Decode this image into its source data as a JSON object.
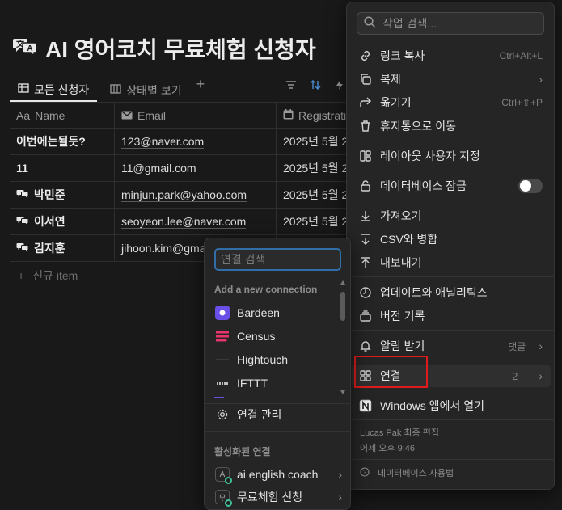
{
  "page": {
    "title": "AI 영어코치 무료체험 신청자",
    "icon": "translate-chat-icon",
    "views": [
      {
        "label": "모든 신청자",
        "icon": "table-icon"
      },
      {
        "label": "상태별 보기",
        "icon": "board-icon"
      }
    ],
    "add_view": "+",
    "toolbar_icons": [
      "filter-icon",
      "sort-icon",
      "automation-icon"
    ],
    "accent_color": "#2f6ea8"
  },
  "table": {
    "columns": [
      {
        "label": "Name",
        "icon": "Aa"
      },
      {
        "label": "Email",
        "icon": "mail-icon"
      },
      {
        "label": "Registration",
        "icon": "calendar-icon"
      }
    ],
    "rows": [
      {
        "name": "이번에는될듯?",
        "email": "123@naver.com",
        "date": "2025년 5월 2",
        "has_icon": false
      },
      {
        "name": "11",
        "email": "11@gmail.com",
        "date": "2025년 5월 2",
        "has_icon": false
      },
      {
        "name": "박민준",
        "email": "minjun.park@yahoo.com",
        "date": "2025년 5월 2",
        "has_icon": true
      },
      {
        "name": "이서연",
        "email": "seoyeon.lee@naver.com",
        "date": "2025년 5월 2",
        "has_icon": true
      },
      {
        "name": "김지훈",
        "email": "jihoon.kim@gma",
        "date": "",
        "has_icon": true
      }
    ],
    "new_item": "신규 item"
  },
  "main_menu": {
    "search_placeholder": "작업 검색...",
    "items": [
      {
        "label": "링크 복사",
        "shortcut": "Ctrl+Alt+L",
        "icon": "link-icon"
      },
      {
        "label": "복제",
        "icon": "duplicate-icon",
        "chevron": true
      },
      {
        "label": "옮기기",
        "shortcut": "Ctrl+⇧+P",
        "icon": "move-arrow-icon"
      },
      {
        "label": "휴지통으로 이동",
        "icon": "trash-icon"
      },
      {
        "label": "레이아웃 사용자 지정",
        "icon": "layout-icon"
      },
      {
        "label": "데이터베이스 잠금",
        "icon": "lock-icon",
        "toggle": false
      },
      {
        "label": "가져오기",
        "icon": "import-icon"
      },
      {
        "label": "CSV와 병합",
        "icon": "merge-icon"
      },
      {
        "label": "내보내기",
        "icon": "export-icon"
      },
      {
        "label": "업데이트와 애널리틱스",
        "icon": "clock-icon"
      },
      {
        "label": "버전 기록",
        "icon": "history-icon"
      },
      {
        "label": "알림 받기",
        "shortcut": "댓글",
        "icon": "bell-icon",
        "chevron": true
      },
      {
        "label": "연결",
        "shortcut": "2",
        "icon": "connections-icon",
        "chevron": true
      },
      {
        "label": "Windows 앱에서 열기",
        "icon": "notion-app-icon"
      }
    ],
    "last_edited": "Lucas Pak 최종 편집",
    "last_edited_time": "어제 오후 9:46",
    "help": "데이터베이스 사용법",
    "highlight_color": "#e01b1b"
  },
  "connection_menu": {
    "search_placeholder": "연결 검색",
    "add_section": "Add a new connection",
    "apps": [
      {
        "label": "Bardeen",
        "color": "#6a4ee8"
      },
      {
        "label": "Census",
        "color": "#e8336b"
      },
      {
        "label": "Hightouch",
        "color": "#2a2a2a"
      },
      {
        "label": "IFTTT",
        "color": "#2a2a2a"
      }
    ],
    "manage": "연결 관리",
    "active_section": "활성화된 연결",
    "active": [
      {
        "label": "ai english coach",
        "badge": "A"
      },
      {
        "label": "무료체험 신청",
        "badge": "무"
      }
    ],
    "active_dot_color": "#3fc29a"
  }
}
